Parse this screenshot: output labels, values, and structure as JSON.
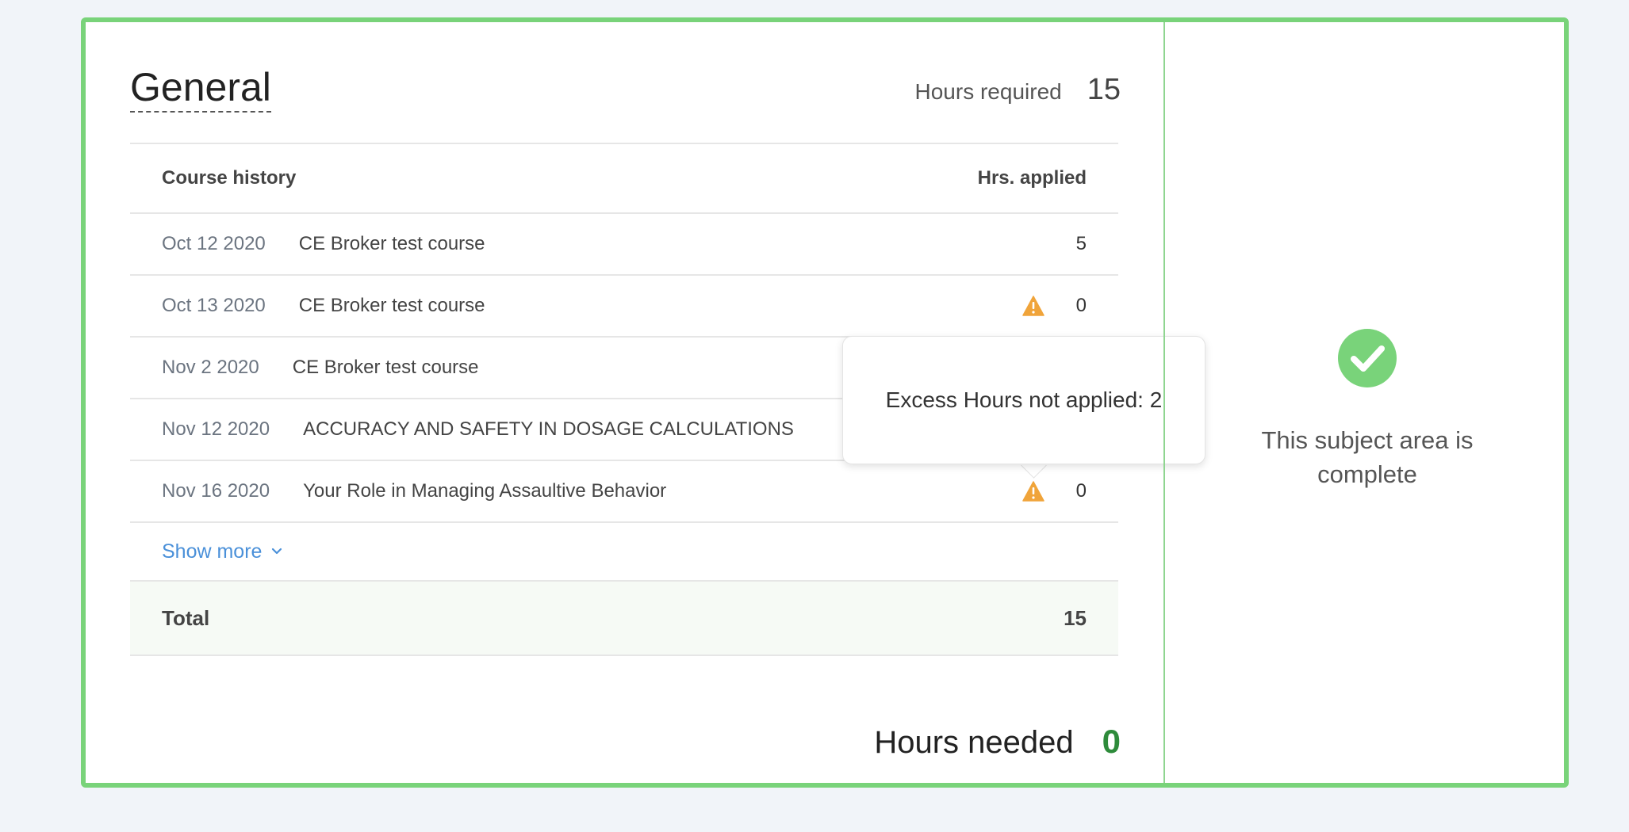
{
  "section": {
    "title": "General",
    "hours_required_label": "Hours required",
    "hours_required_value": "15"
  },
  "table": {
    "col_course": "Course history",
    "col_hours": "Hrs. applied",
    "rows": [
      {
        "date": "Oct 12 2020",
        "name": "CE Broker test course",
        "hours": "5",
        "warning": false
      },
      {
        "date": "Oct 13 2020",
        "name": "CE Broker test course",
        "hours": "0",
        "warning": true
      },
      {
        "date": "Nov 2 2020",
        "name": "CE Broker test course",
        "hours": "",
        "warning": false
      },
      {
        "date": "Nov 12 2020",
        "name": "ACCURACY AND SAFETY IN DOSAGE CALCULATIONS",
        "hours": "",
        "warning": false
      },
      {
        "date": "Nov 16 2020",
        "name": "Your Role in Managing Assaultive Behavior",
        "hours": "0",
        "warning": true
      }
    ],
    "show_more": "Show more",
    "total_label": "Total",
    "total_value": "15"
  },
  "hours_needed": {
    "label": "Hours needed",
    "value": "0"
  },
  "tooltip": {
    "text": "Excess Hours not applied: 2"
  },
  "status": {
    "text": "This subject area is complete"
  },
  "icons": {
    "warning": "warning-triangle-icon",
    "complete": "check-circle-icon",
    "chevron": "chevron-down-icon"
  },
  "colors": {
    "accent_green": "#79d37a",
    "warning_orange": "#f0a43a",
    "link_blue": "#4a90d9",
    "needed_green": "#2e8b3b"
  }
}
